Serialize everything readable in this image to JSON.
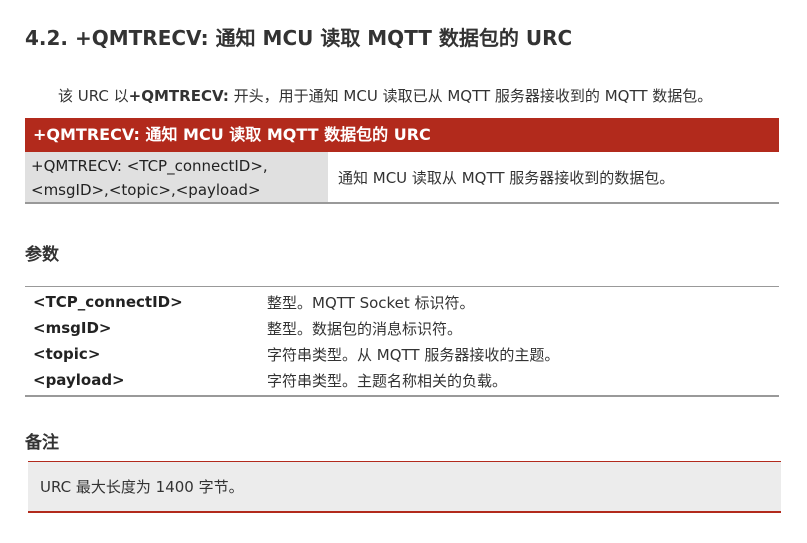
{
  "section": {
    "title": "4.2. +QMTRECV:   通知 MCU 读取 MQTT 数据包的 URC"
  },
  "intro": {
    "prefix": "该 URC 以",
    "command": "+QMTRECV:",
    "suffix": " 开头，用于通知 MCU 读取已从 MQTT 服务器接收到的 MQTT 数据包。"
  },
  "urc_table": {
    "header": "+QMTRECV:   通知 MCU 读取 MQTT 数据包的 URC",
    "syntax": "+QMTRECV: <TCP_connectID>,<msgID>,<topic>,<payload>",
    "description": "通知 MCU 读取从 MQTT 服务器接收到的数据包。"
  },
  "parameters": {
    "heading": "参数",
    "rows": [
      {
        "name": "<TCP_connectID>",
        "desc": "整型。MQTT Socket 标识符。"
      },
      {
        "name": "<msgID>",
        "desc": "整型。数据包的消息标识符。"
      },
      {
        "name": "<topic>",
        "desc": "字符串类型。从 MQTT 服务器接收的主题。"
      },
      {
        "name": "<payload>",
        "desc": "字符串类型。主题名称相关的负载。"
      }
    ]
  },
  "notes": {
    "heading": "备注",
    "text": "URC 最大长度为 1400 字节。"
  },
  "colors": {
    "accent": "#b22a1c",
    "syntax_bg": "#e0e0e0",
    "note_bg": "#ececec"
  }
}
